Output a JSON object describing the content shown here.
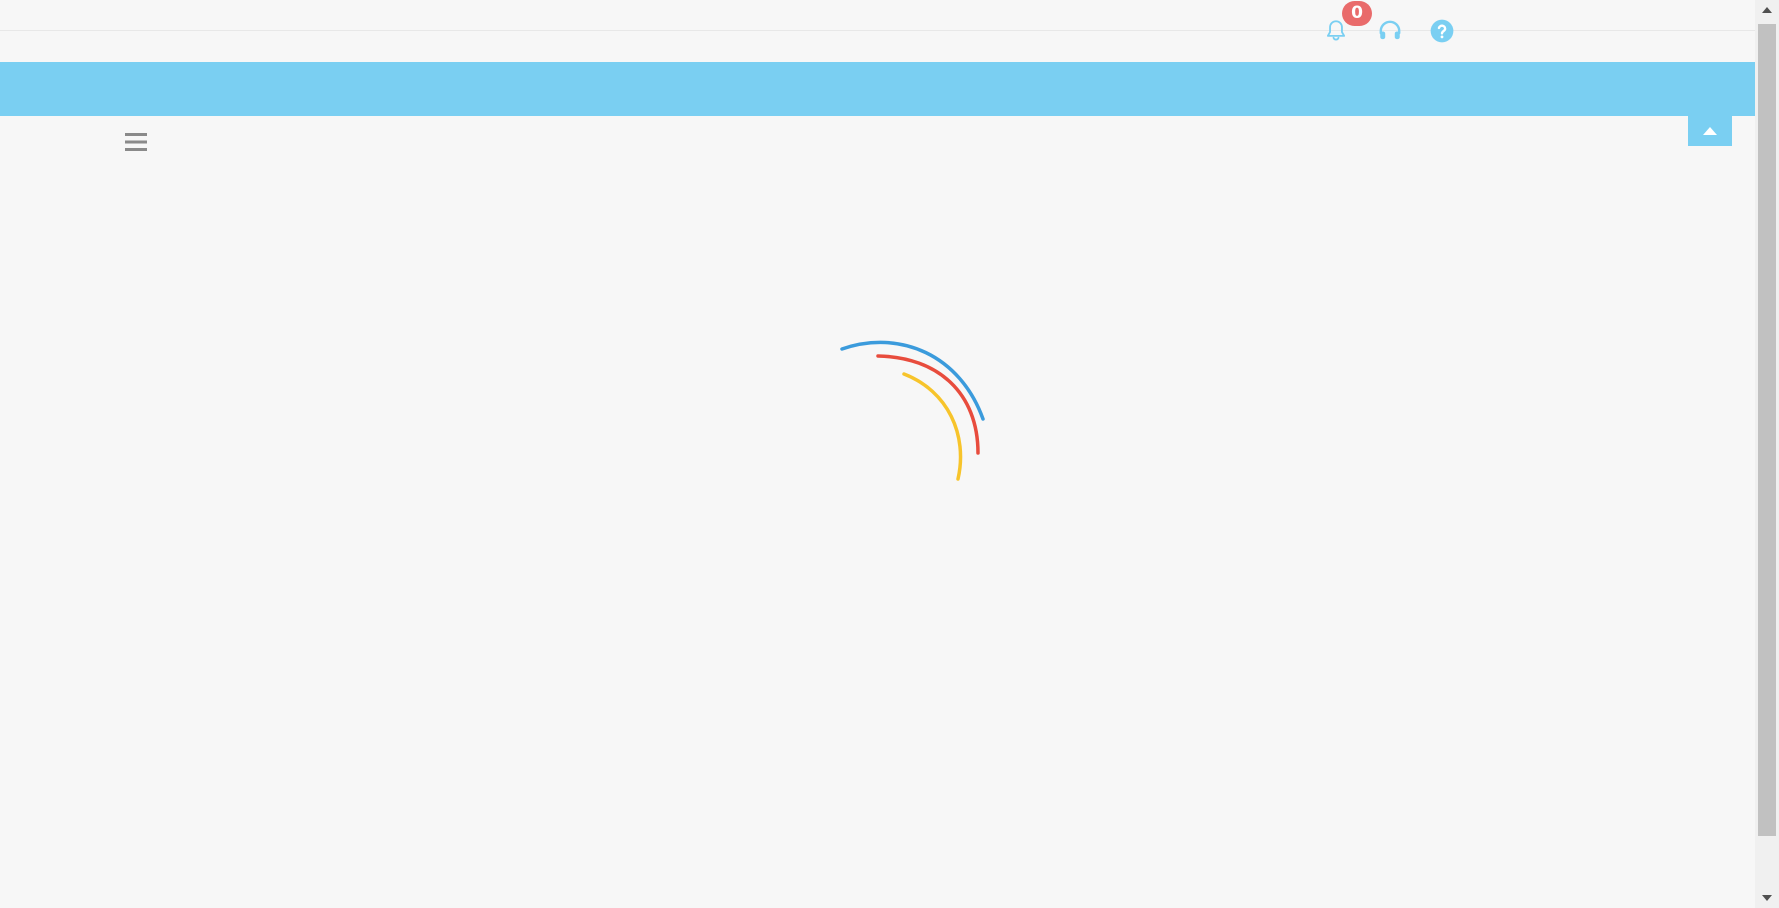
{
  "header": {
    "notifications": {
      "icon": "bell-icon",
      "count": "0",
      "badge_color": "#e96b6b"
    },
    "support": {
      "icon": "headset-icon"
    },
    "help": {
      "icon": "help-circle-icon"
    },
    "accent_color": "#7acff2"
  },
  "banner": {
    "color": "#7acff2",
    "collapse_icon": "caret-up-icon"
  },
  "menu": {
    "icon": "hamburger-menu-icon"
  },
  "loader": {
    "type": "spinner",
    "colors": [
      "#3b9bdc",
      "#e84c3d",
      "#f7c42b"
    ]
  },
  "scrollbar": {
    "up_icon": "scroll-up-arrow-icon",
    "down_icon": "scroll-down-arrow-icon"
  }
}
